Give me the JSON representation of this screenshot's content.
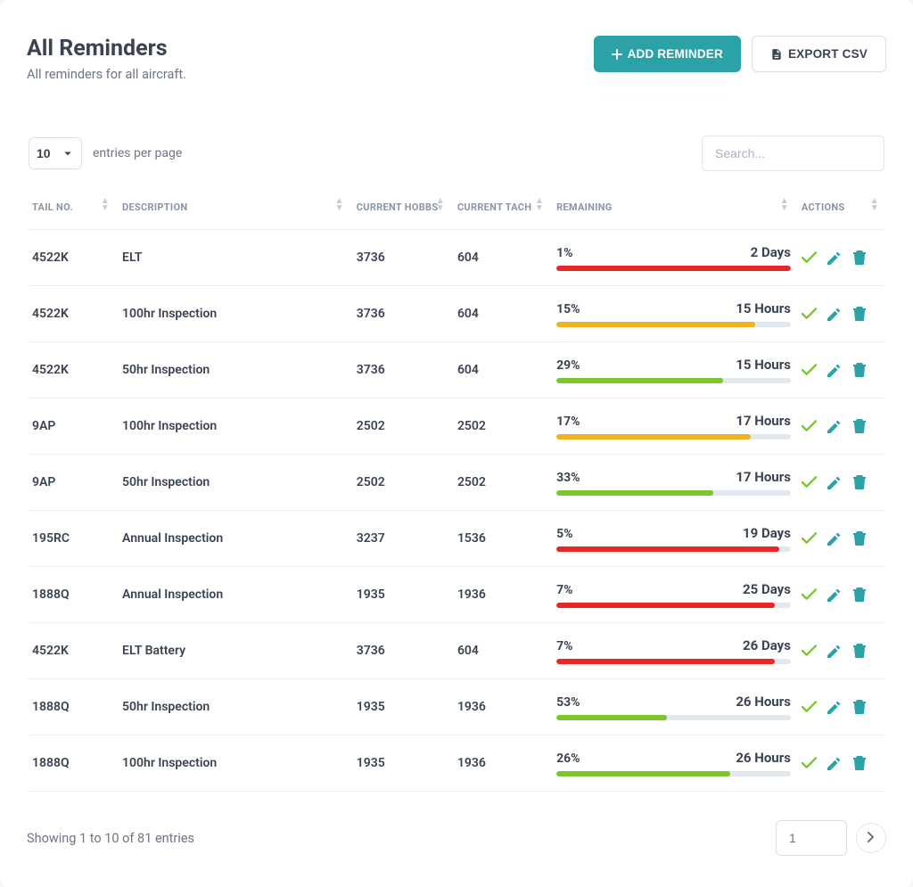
{
  "header": {
    "title": "All Reminders",
    "subtitle": "All reminders for all aircraft.",
    "add_button": "ADD REMINDER",
    "export_button": "EXPORT CSV"
  },
  "toolbar": {
    "page_size": "10",
    "entries_label": "entries per page",
    "search_placeholder": "Search..."
  },
  "columns": {
    "tail": "TAIL NO.",
    "description": "DESCRIPTION",
    "hobbs": "CURRENT HOBBS",
    "tach": "CURRENT TACH",
    "remaining": "REMAINING",
    "actions": "ACTIONS"
  },
  "rows": [
    {
      "tail": "4522K",
      "description": "ELT",
      "hobbs": "3736",
      "tach": "604",
      "pct": "1%",
      "time": "2 Days",
      "bar_width": "100%",
      "bar_class": "bar-red"
    },
    {
      "tail": "4522K",
      "description": "100hr Inspection",
      "hobbs": "3736",
      "tach": "604",
      "pct": "15%",
      "time": "15 Hours",
      "bar_width": "85%",
      "bar_class": "bar-yellow"
    },
    {
      "tail": "4522K",
      "description": "50hr Inspection",
      "hobbs": "3736",
      "tach": "604",
      "pct": "29%",
      "time": "15 Hours",
      "bar_width": "71%",
      "bar_class": "bar-green"
    },
    {
      "tail": "9AP",
      "description": "100hr Inspection",
      "hobbs": "2502",
      "tach": "2502",
      "pct": "17%",
      "time": "17 Hours",
      "bar_width": "83%",
      "bar_class": "bar-yellow"
    },
    {
      "tail": "9AP",
      "description": "50hr Inspection",
      "hobbs": "2502",
      "tach": "2502",
      "pct": "33%",
      "time": "17 Hours",
      "bar_width": "67%",
      "bar_class": "bar-green"
    },
    {
      "tail": "195RC",
      "description": "Annual Inspection",
      "hobbs": "3237",
      "tach": "1536",
      "pct": "5%",
      "time": "19 Days",
      "bar_width": "95%",
      "bar_class": "bar-red"
    },
    {
      "tail": "1888Q",
      "description": "Annual Inspection",
      "hobbs": "1935",
      "tach": "1936",
      "pct": "7%",
      "time": "25 Days",
      "bar_width": "93%",
      "bar_class": "bar-red"
    },
    {
      "tail": "4522K",
      "description": "ELT Battery",
      "hobbs": "3736",
      "tach": "604",
      "pct": "7%",
      "time": "26 Days",
      "bar_width": "93%",
      "bar_class": "bar-red"
    },
    {
      "tail": "1888Q",
      "description": "50hr Inspection",
      "hobbs": "1935",
      "tach": "1936",
      "pct": "53%",
      "time": "26 Hours",
      "bar_width": "47%",
      "bar_class": "bar-green"
    },
    {
      "tail": "1888Q",
      "description": "100hr Inspection",
      "hobbs": "1935",
      "tach": "1936",
      "pct": "26%",
      "time": "26 Hours",
      "bar_width": "74%",
      "bar_class": "bar-green"
    }
  ],
  "footer": {
    "status": "Showing 1 to 10 of 81 entries",
    "page": "1"
  }
}
